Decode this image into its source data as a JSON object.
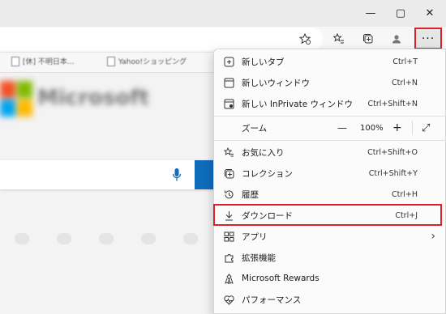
{
  "window": {
    "minimize_glyph": "—",
    "maximize_glyph": "▢",
    "close_glyph": "✕"
  },
  "toolbar": {
    "more_glyph": "···"
  },
  "favorites": {
    "items": [
      "[休] 不明日本...",
      "Yahoo!ショッピング"
    ]
  },
  "page": {
    "logo_text": "Microsoft"
  },
  "menu": {
    "new_tab": {
      "label": "新しいタブ",
      "shortcut": "Ctrl+T",
      "icon": "new-tab-icon"
    },
    "new_window": {
      "label": "新しいウィンドウ",
      "shortcut": "Ctrl+N",
      "icon": "new-window-icon"
    },
    "new_inprivate": {
      "label": "新しい InPrivate ウィンドウ",
      "shortcut": "Ctrl+Shift+N",
      "icon": "inprivate-icon"
    },
    "zoom": {
      "label": "ズーム",
      "minus": "—",
      "value": "100%",
      "plus": "+",
      "fullscreen": "⤢"
    },
    "favorites": {
      "label": "お気に入り",
      "shortcut": "Ctrl+Shift+O",
      "icon": "favorites-icon"
    },
    "collections": {
      "label": "コレクション",
      "shortcut": "Ctrl+Shift+Y",
      "icon": "collections-icon"
    },
    "history": {
      "label": "履歴",
      "shortcut": "Ctrl+H",
      "icon": "history-icon"
    },
    "downloads": {
      "label": "ダウンロード",
      "shortcut": "Ctrl+J",
      "icon": "download-icon"
    },
    "apps": {
      "label": "アプリ",
      "arrow": "›",
      "icon": "apps-icon"
    },
    "extensions": {
      "label": "拡張機能",
      "icon": "extensions-icon"
    },
    "rewards": {
      "label": "Microsoft Rewards",
      "icon": "rewards-icon"
    },
    "performance": {
      "label": "パフォーマンス",
      "icon": "performance-icon"
    }
  },
  "colors": {
    "highlight_red": "#d8232a",
    "search_button_blue": "#0f6cbd"
  }
}
